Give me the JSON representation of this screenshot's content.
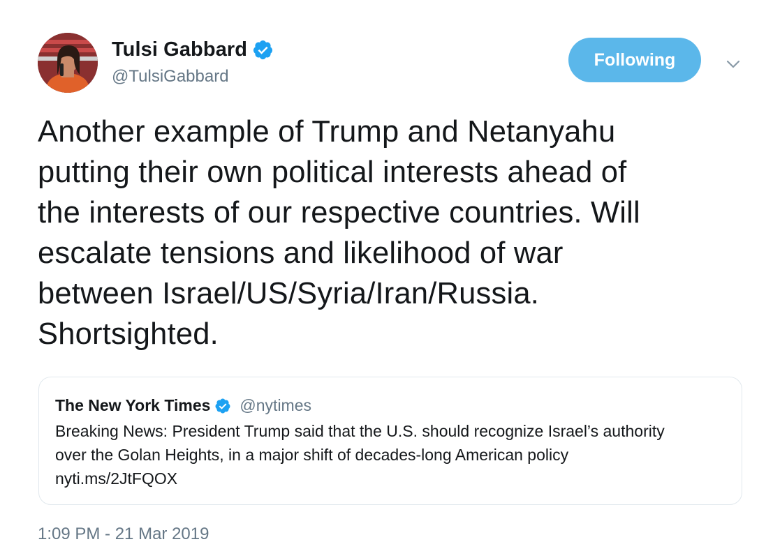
{
  "author": {
    "name": "Tulsi Gabbard",
    "handle": "@TulsiGabbard",
    "follow_label": "Following"
  },
  "tweet": {
    "lines": [
      "Another example of Trump and Netanyahu",
      "putting their own political interests ahead of",
      "the interests of our respective countries. Will",
      "escalate tensions and likelihood of war",
      "between Israel/US/Syria/Iran/Russia.",
      "Shortsighted."
    ],
    "timestamp": "1:09 PM - 21 Mar 2019"
  },
  "quoted": {
    "name": "The New York Times",
    "handle": "@nytimes",
    "lines": [
      "Breaking News: President Trump said that the U.S. should recognize Israel’s authority",
      "over the Golan Heights, in a major shift of decades-long American policy",
      "nyti.ms/2JtFQOX"
    ]
  },
  "icons": {
    "verified": "verified-badge-icon",
    "caret": "chevron-down-icon"
  },
  "colors": {
    "follow_button": "#5bb7ea",
    "verified": "#1da1f2",
    "secondary_text": "#657786",
    "border": "#e1e8ed"
  }
}
